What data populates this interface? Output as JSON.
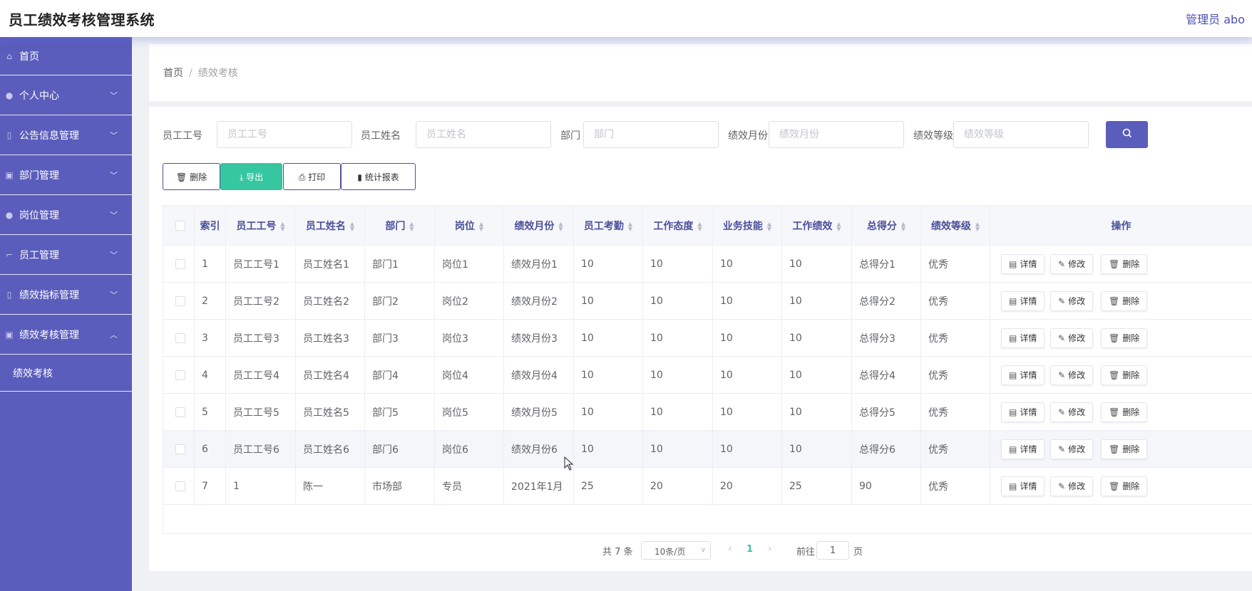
{
  "header": {
    "title": "员工绩效考核管理系统",
    "user": "管理员 abo"
  },
  "sidebar": {
    "items": [
      {
        "label": "首页",
        "icon": "home-icon",
        "glyph": "⌂",
        "chevron": ""
      },
      {
        "label": "个人中心",
        "icon": "user-icon",
        "glyph": "●",
        "chevron": "﹀"
      },
      {
        "label": "公告信息管理",
        "icon": "microphone-icon",
        "glyph": "▯",
        "chevron": "﹀"
      },
      {
        "label": "部门管理",
        "icon": "clipboard-icon",
        "glyph": "▣",
        "chevron": "﹀"
      },
      {
        "label": "岗位管理",
        "icon": "user-icon",
        "glyph": "●",
        "chevron": "﹀"
      },
      {
        "label": "员工管理",
        "icon": "crop-icon",
        "glyph": "⌐",
        "chevron": "﹀"
      },
      {
        "label": "绩效指标管理",
        "icon": "microphone-icon",
        "glyph": "▯",
        "chevron": "﹀"
      },
      {
        "label": "绩效考核管理",
        "icon": "clipboard-icon",
        "glyph": "▣",
        "chevron": "︿"
      }
    ],
    "subitem": "绩效考核"
  },
  "breadcrumb": {
    "home": "首页",
    "sep": "/",
    "current": "绩效考核"
  },
  "search": {
    "fields": [
      {
        "label": "员工工号",
        "placeholder": "员工工号"
      },
      {
        "label": "员工姓名",
        "placeholder": "员工姓名"
      },
      {
        "label": "部门",
        "placeholder": "部门"
      },
      {
        "label": "绩效月份",
        "placeholder": "绩效月份"
      },
      {
        "label": "绩效等级",
        "placeholder": "绩效等级"
      }
    ],
    "button_icon": "search-icon"
  },
  "actions": {
    "delete": "删除",
    "export": "导出",
    "print": "打印",
    "report": "统计报表"
  },
  "table": {
    "columns": [
      "索引",
      "员工工号",
      "员工姓名",
      "部门",
      "岗位",
      "绩效月份",
      "员工考勤",
      "工作态度",
      "业务技能",
      "工作绩效",
      "总得分",
      "绩效等级",
      "操作"
    ],
    "rows": [
      [
        "1",
        "员工工号1",
        "员工姓名1",
        "部门1",
        "岗位1",
        "绩效月份1",
        "10",
        "10",
        "10",
        "10",
        "总得分1",
        "优秀"
      ],
      [
        "2",
        "员工工号2",
        "员工姓名2",
        "部门2",
        "岗位2",
        "绩效月份2",
        "10",
        "10",
        "10",
        "10",
        "总得分2",
        "优秀"
      ],
      [
        "3",
        "员工工号3",
        "员工姓名3",
        "部门3",
        "岗位3",
        "绩效月份3",
        "10",
        "10",
        "10",
        "10",
        "总得分3",
        "优秀"
      ],
      [
        "4",
        "员工工号4",
        "员工姓名4",
        "部门4",
        "岗位4",
        "绩效月份4",
        "10",
        "10",
        "10",
        "10",
        "总得分4",
        "优秀"
      ],
      [
        "5",
        "员工工号5",
        "员工姓名5",
        "部门5",
        "岗位5",
        "绩效月份5",
        "10",
        "10",
        "10",
        "10",
        "总得分5",
        "优秀"
      ],
      [
        "6",
        "员工工号6",
        "员工姓名6",
        "部门6",
        "岗位6",
        "绩效月份6",
        "10",
        "10",
        "10",
        "10",
        "总得分6",
        "优秀"
      ],
      [
        "7",
        "1",
        "陈一",
        "市场部",
        "专员",
        "2021年1月",
        "25",
        "20",
        "20",
        "25",
        "90",
        "优秀"
      ]
    ],
    "row_actions": {
      "detail": "详情",
      "edit": "修改",
      "delete": "删除"
    },
    "highlighted_row": 6
  },
  "pagination": {
    "total": "共 7 条",
    "page_size": "10条/页",
    "current_page": "1",
    "goto_label": "前往",
    "goto_value": "1",
    "page_suffix": "页"
  },
  "colors": {
    "primary": "#5a5dbb",
    "accent": "#36c6a0",
    "header_text": "#4b4f9a"
  }
}
